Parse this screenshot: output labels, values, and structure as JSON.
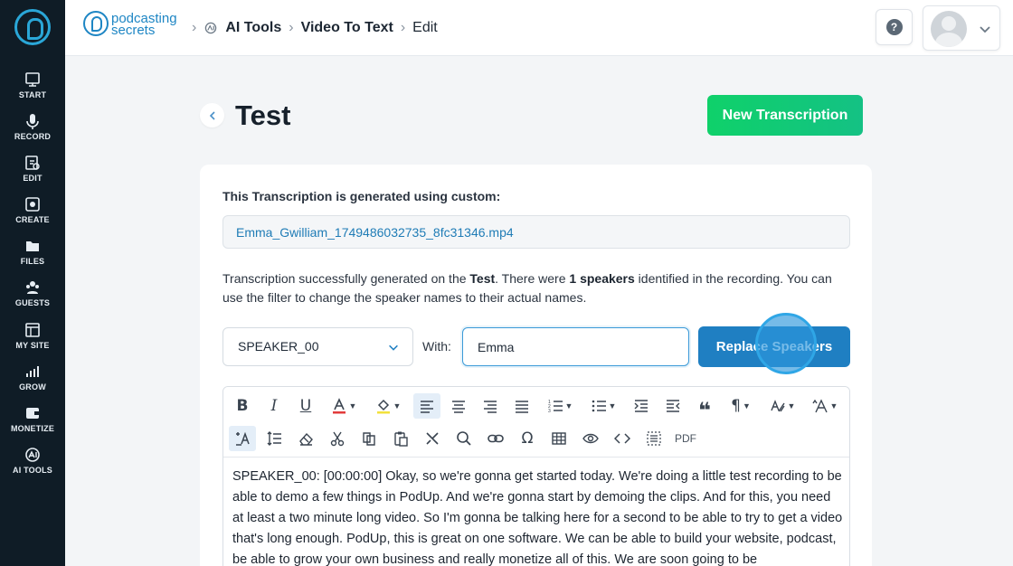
{
  "sidebar": {
    "items": [
      {
        "label": "START",
        "icon": "start-icon"
      },
      {
        "label": "RECORD",
        "icon": "microphone-icon"
      },
      {
        "label": "EDIT",
        "icon": "edit-icon"
      },
      {
        "label": "CREATE",
        "icon": "create-icon"
      },
      {
        "label": "FILES",
        "icon": "files-icon"
      },
      {
        "label": "GUESTS",
        "icon": "guests-icon"
      },
      {
        "label": "MY SITE",
        "icon": "my-site-icon"
      },
      {
        "label": "GROW",
        "icon": "grow-icon"
      },
      {
        "label": "MONETIZE",
        "icon": "monetize-icon"
      },
      {
        "label": "AI TOOLS",
        "icon": "ai-tools-icon"
      }
    ]
  },
  "header": {
    "brand_line1": "podcasting",
    "brand_line2": "secrets",
    "breadcrumb": [
      "AI Tools",
      "Video To Text",
      "Edit"
    ],
    "help_label": "?"
  },
  "page": {
    "title": "Test",
    "new_button": "New Transcription"
  },
  "card": {
    "generated_label": "This Transcription is generated using custom:",
    "file_name": "Emma_Gwilliam_1749486032735_8fc31346.mp4",
    "desc_pre": "Transcription successfully generated on the ",
    "desc_title": "Test",
    "desc_mid": ". There were ",
    "desc_speakers": "1 speakers",
    "desc_post": " identified in the recording. You can use the filter to change the speaker names to their actual names.",
    "speaker_selected": "SPEAKER_00",
    "with_label": "With:",
    "with_value": "Emma",
    "replace_button": "Replace Speakers"
  },
  "editor": {
    "pdf_label": "PDF",
    "text": "SPEAKER_00: [00:00:00] Okay, so we're gonna get started today. We're doing a little test recording to be able to demo a few things in PodUp. And we're gonna start by demoing the clips. And for this, you need at least a two minute long video. So I'm gonna be talking here for a second to be able to try to get a video that's long enough. PodUp, this is great on one software. We can be able to build your website, podcast, be able to grow your own business and really monetize all of this. We are soon going to be"
  },
  "colors": {
    "sidebar_bg": "#0f1c26",
    "accent_blue": "#1f7fc2",
    "accent_green": "#0fd16a"
  }
}
